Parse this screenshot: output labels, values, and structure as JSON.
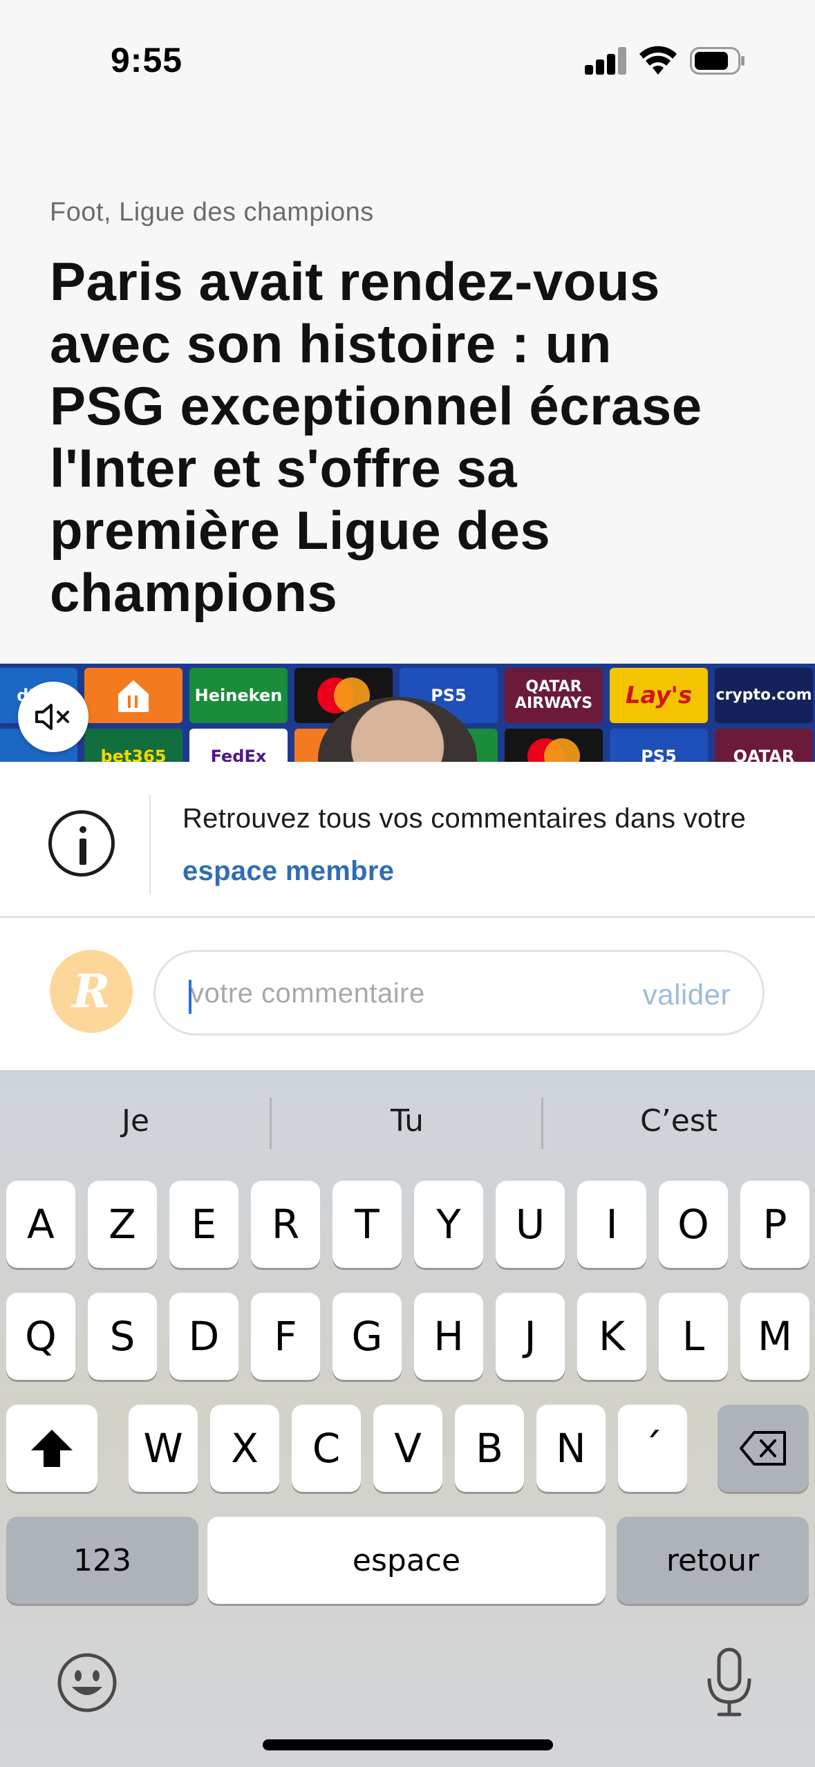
{
  "status_bar": {
    "time": "9:55"
  },
  "article": {
    "category": "Foot, Ligue des champions",
    "headline_lines": [
      "Paris avait rendez-vous",
      "avec son histoire : un",
      "PSG exceptionnel écrase",
      "l'Inter et s'offre sa",
      "première Ligue des",
      "champions"
    ]
  },
  "video": {
    "sponsors_top": [
      "dF",
      "",
      "Heineken",
      "",
      "PS5",
      "QATAR AIRWAYS",
      "Lay's",
      "crypto.com",
      ""
    ],
    "sponsors_bottom": [
      "",
      "bet365",
      "FedEx",
      "",
      "",
      "",
      "PS5",
      "QATAR"
    ]
  },
  "info": {
    "text_prefix": "Retrouvez tous vos commentaires dans votre ",
    "link_label": "espace membre"
  },
  "comment": {
    "avatar_letter": "R",
    "placeholder": "votre commentaire",
    "submit_label": "valider"
  },
  "keyboard": {
    "suggestions": [
      "Je",
      "Tu",
      "C’est"
    ],
    "row1": [
      "A",
      "Z",
      "E",
      "R",
      "T",
      "Y",
      "U",
      "I",
      "O",
      "P"
    ],
    "row2": [
      "Q",
      "S",
      "D",
      "F",
      "G",
      "H",
      "J",
      "K",
      "L",
      "M"
    ],
    "row3": [
      "W",
      "X",
      "C",
      "V",
      "B",
      "N",
      "´"
    ],
    "numbers_label": "123",
    "space_label": "espace",
    "return_label": "retour"
  },
  "colors": {
    "accent_link": "#2f6db5",
    "submit": "#9cbbdc",
    "avatar": "#fdd79a",
    "caret": "#2d6cdf"
  }
}
